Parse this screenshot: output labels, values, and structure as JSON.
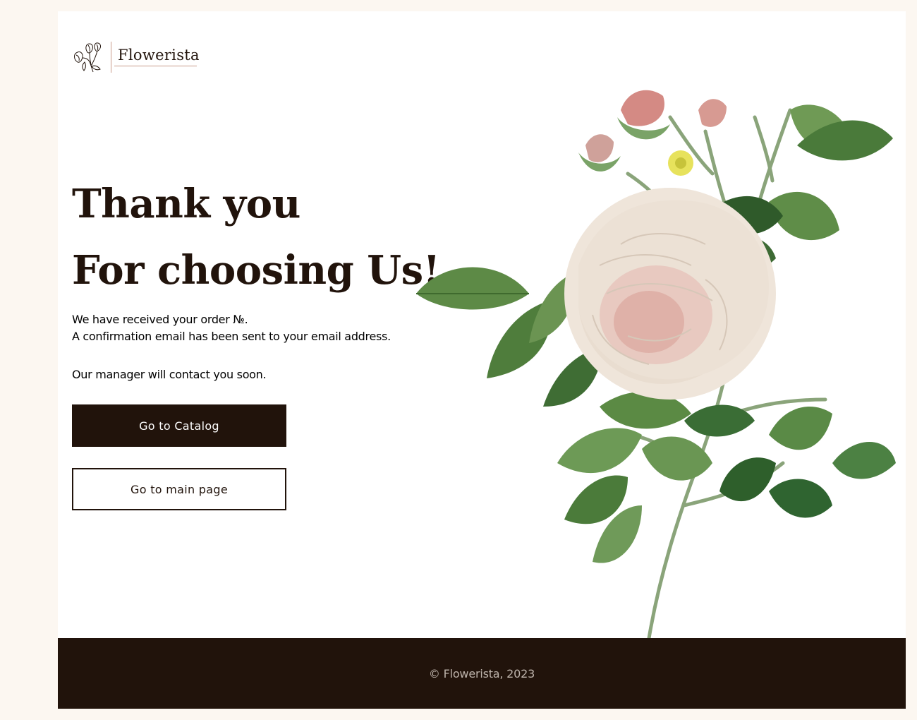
{
  "brand": {
    "name": "Flowerista",
    "accent_color": "#c99a8a",
    "logo_icon": "flower-sketch-icon"
  },
  "hero": {
    "title_line1": "Thank you",
    "title_line2": "For choosing Us!",
    "message_line1": "We have received your order №.",
    "message_line2": "A confirmation email has been sent to your email address.",
    "message_line3": "Our manager will contact you soon."
  },
  "actions": {
    "catalog_label": "Go to Catalog",
    "main_page_label": "Go to main page"
  },
  "illustration": {
    "subject": "rose-illustration"
  },
  "footer": {
    "copyright": "© Flowerista, 2023"
  },
  "colors": {
    "background": "#fcf7f1",
    "panel": "#ffffff",
    "dark": "#21130b",
    "footer_text": "#bdb3ab"
  }
}
